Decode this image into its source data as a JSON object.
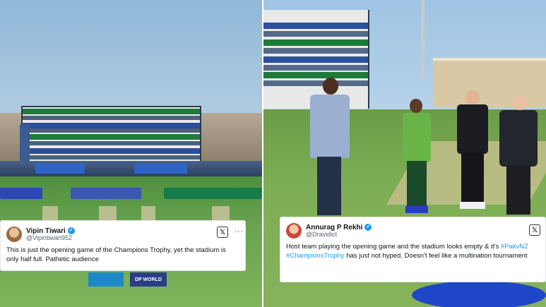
{
  "left_tweet": {
    "name": "Vipin Tiwari",
    "handle": "@Vipintiwari952",
    "text": "This is just the opening game of the Champions Trophy, yet the stadium is only half full. Pathetic audience",
    "menu": "···",
    "x_icon": "x-logo-icon"
  },
  "right_tweet": {
    "name": "Annurag P Rekhi",
    "handle": "@Dravidict",
    "text_before": "Host team playing the opening game and the stadium looks empty & it's ",
    "hashtag1": "#PakvNZ",
    "hashtag2": "#ChampionsTrophy",
    "text_after": " has just not hyped. Doesn't feel like a multination tournament",
    "x_icon": "x-logo-icon"
  },
  "ad_boards": {
    "left_ad": "DP WORLD"
  },
  "colors": {
    "verified": "#1d9bf0",
    "hashtag": "#1d9bf0",
    "grass": "#7eae55",
    "stand_green": "#1f7a3b",
    "stand_blue": "#2b4e9a"
  }
}
